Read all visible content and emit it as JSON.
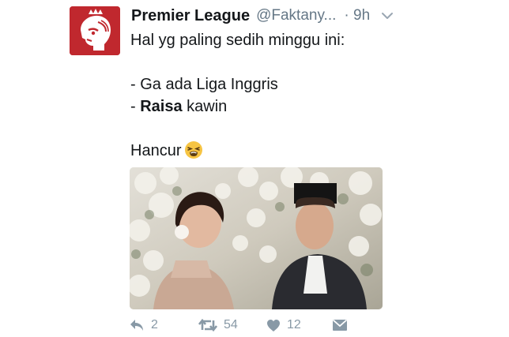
{
  "tweet": {
    "author_name": "Premier League",
    "author_handle": "@Faktany...",
    "timestamp": "· 9h",
    "lines": {
      "line1": "Hal yg paling sedih minggu ini:",
      "line2": "- Ga ada Liga Inggris",
      "line3_prefix": "- ",
      "line3_bold": "Raisa",
      "line3_suffix": " kawin",
      "line4": "Hancur"
    },
    "icons": {
      "avatar": "premier-league-lion-logo",
      "menu": "chevron-down-icon",
      "emoji": "tired-face-emoji",
      "reply": "reply-icon",
      "retweet": "retweet-icon",
      "like": "heart-icon",
      "dm": "direct-message-icon"
    },
    "image": "wedding photo of a couple",
    "actions": {
      "reply_count": "2",
      "retweet_count": "54",
      "like_count": "12"
    }
  },
  "colors": {
    "avatar_bg": "#c0282e",
    "secondary_text": "#657786",
    "action_icons": "#8899a6"
  }
}
